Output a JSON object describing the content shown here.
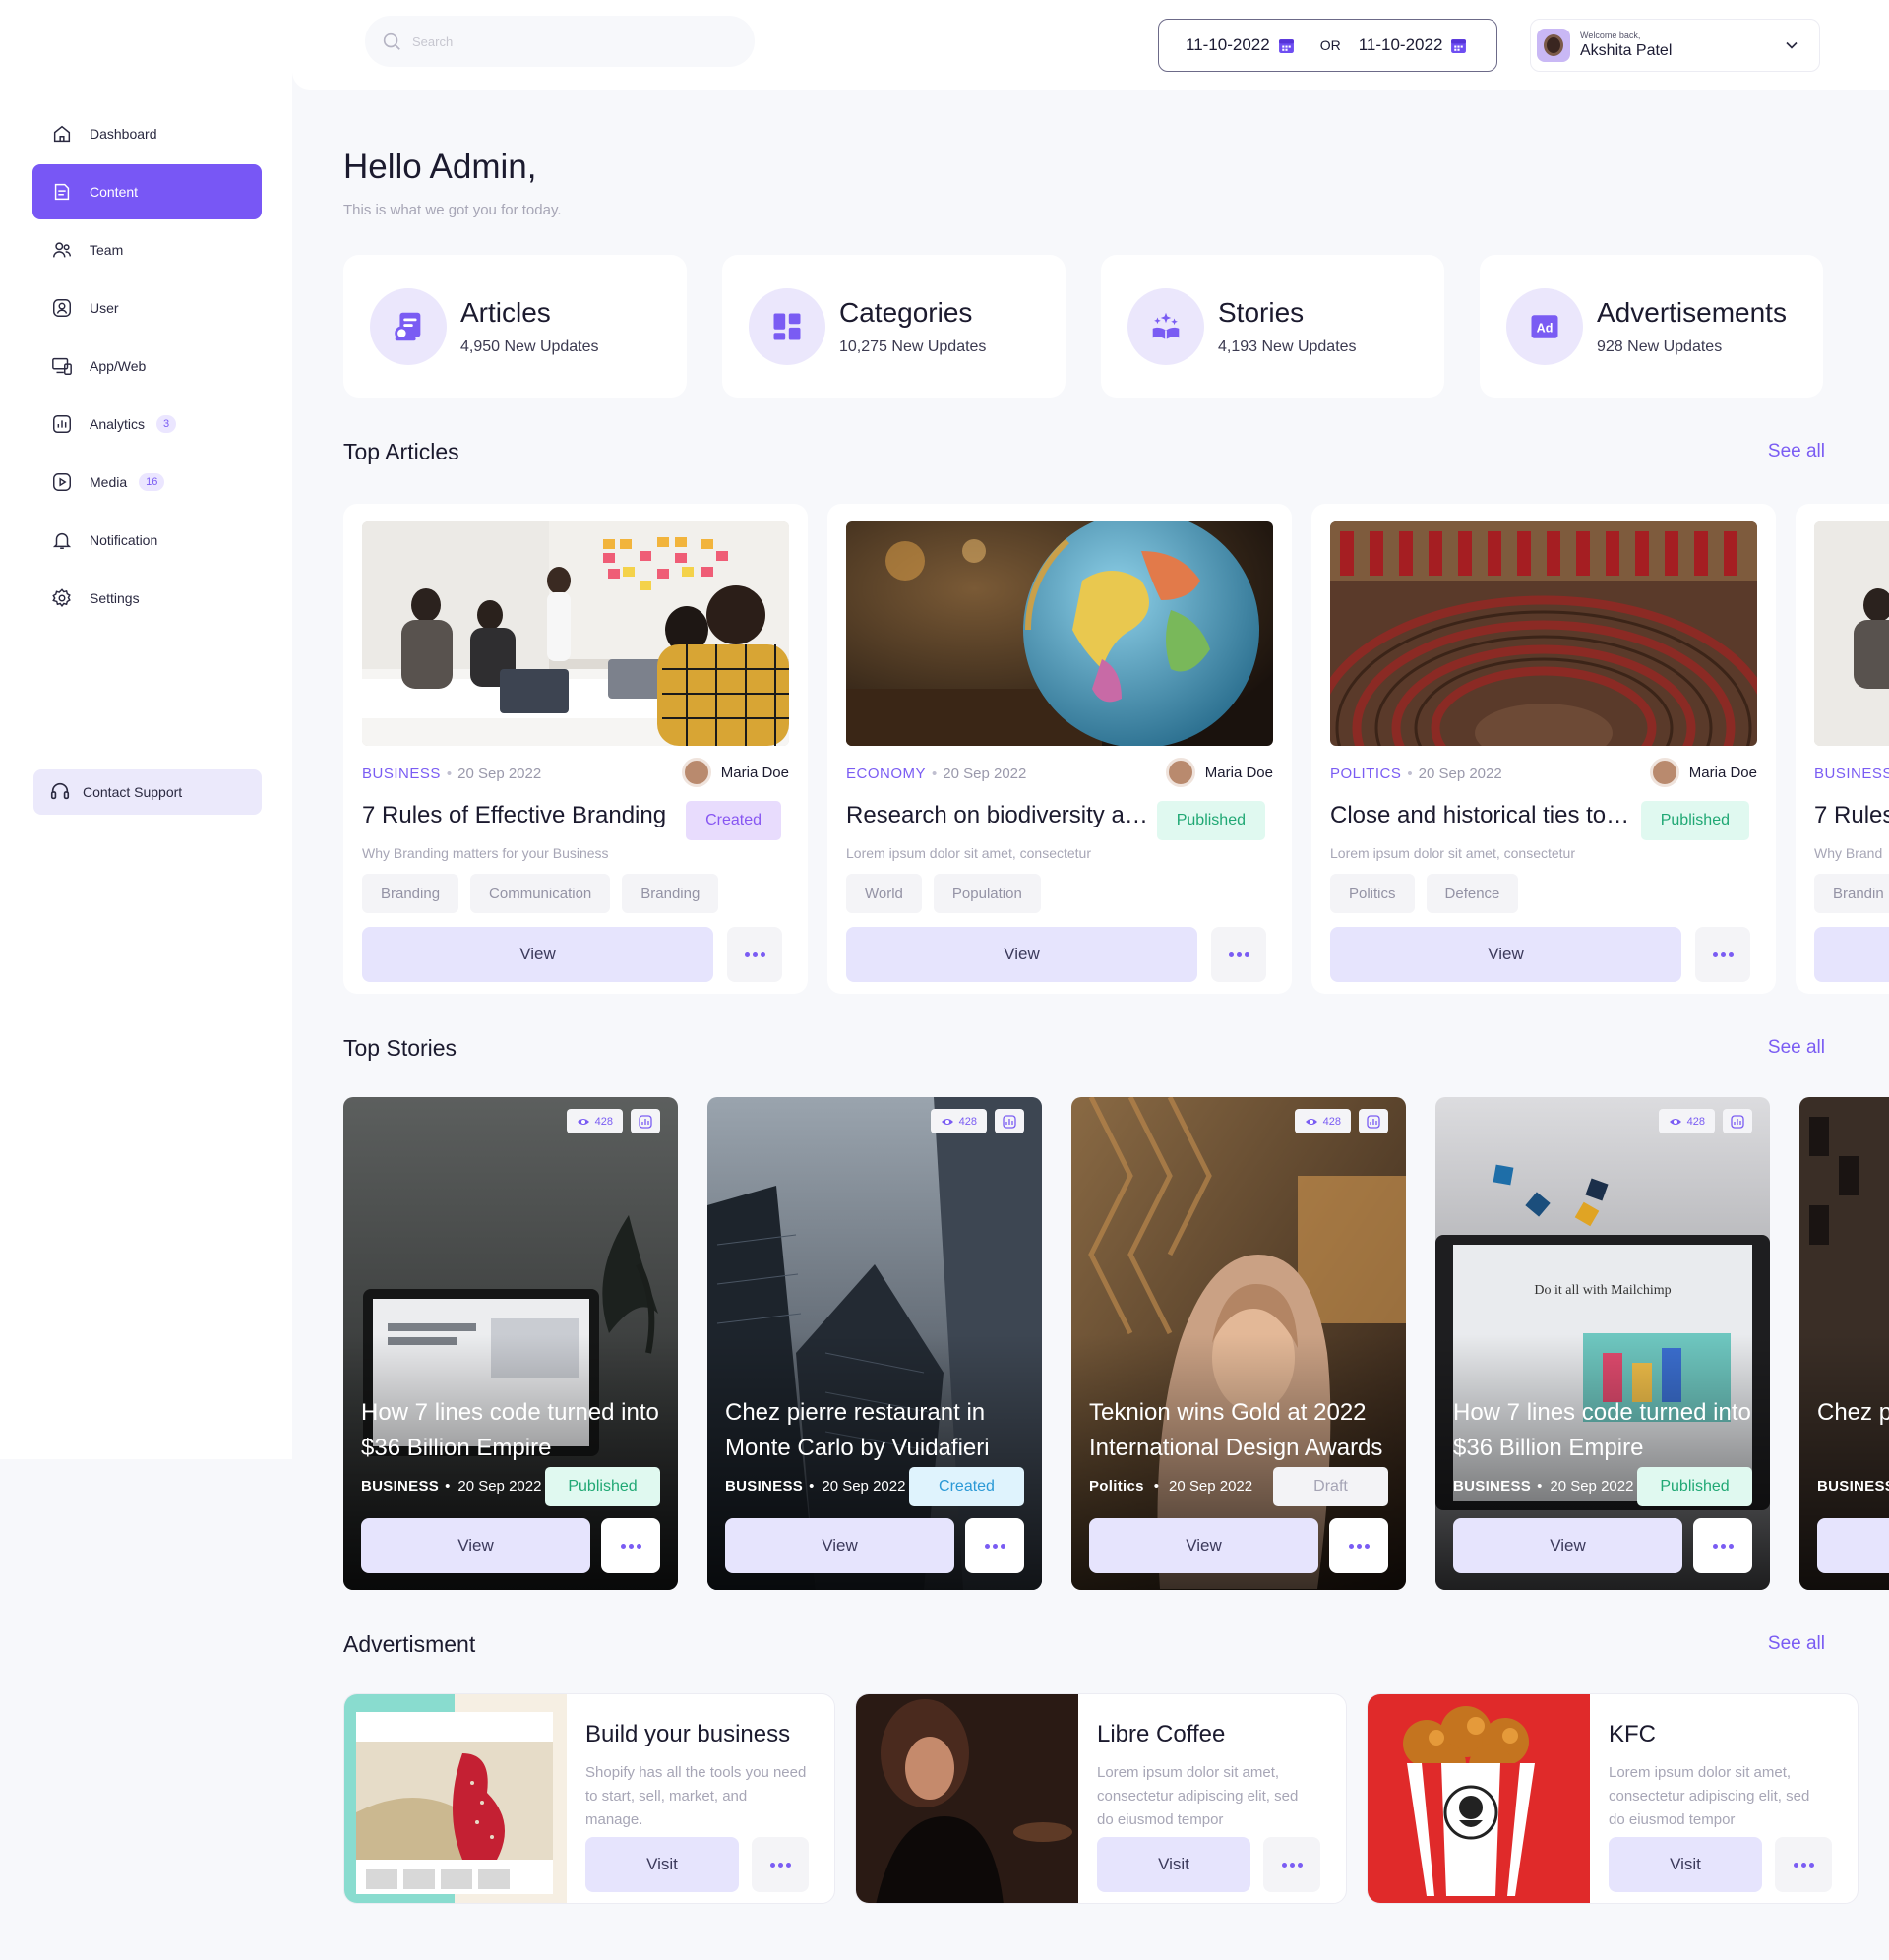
{
  "colors": {
    "accent": "#7857f5",
    "accent_light": "#e6e4fd",
    "published": "#20a874",
    "background": "#f7f8fb"
  },
  "sidebar": {
    "items": [
      {
        "label": "Dashboard",
        "icon": "home-icon"
      },
      {
        "label": "Content",
        "icon": "document-icon",
        "active": true
      },
      {
        "label": "Team",
        "icon": "team-icon"
      },
      {
        "label": "User",
        "icon": "user-icon"
      },
      {
        "label": "App/Web",
        "icon": "devices-icon"
      },
      {
        "label": "Analytics",
        "icon": "analytics-icon",
        "badge": "3"
      },
      {
        "label": "Media",
        "icon": "play-icon",
        "badge": "16"
      },
      {
        "label": "Notification",
        "icon": "bell-icon"
      },
      {
        "label": "Settings",
        "icon": "gear-icon"
      }
    ],
    "support_label": "Contact Support"
  },
  "topbar": {
    "search_placeholder": "Search",
    "date_from": "11-10-2022",
    "date_or": "OR",
    "date_to": "11-10-2022",
    "welcome": "Welcome back,",
    "user_name": "Akshita Patel"
  },
  "greeting": {
    "title": "Hello Admin,",
    "subtitle": "This is what we got you for today."
  },
  "stats": [
    {
      "title": "Articles",
      "sub": "4,950 New Updates"
    },
    {
      "title": "Categories",
      "sub": "10,275 New Updates"
    },
    {
      "title": "Stories",
      "sub": "4,193 New Updates"
    },
    {
      "title": "Advertisements",
      "sub": "928 New Updates"
    }
  ],
  "sections": {
    "top_articles": "Top Articles",
    "top_stories": "Top Stories",
    "advertisement": "Advertisment",
    "see_all": "See all"
  },
  "articles": [
    {
      "category": "BUSINESS",
      "date": "20 Sep 2022",
      "author": "Maria Doe",
      "title": "7 Rules of Effective Branding",
      "status": "Created",
      "desc": "Why Branding matters for your Business",
      "tags": [
        "Branding",
        "Communication",
        "Branding"
      ]
    },
    {
      "category": "ECONOMY",
      "date": "20 Sep 2022",
      "author": "Maria Doe",
      "title": "Research on biodiversity an...",
      "status": "Published",
      "desc": "Lorem ipsum dolor sit amet, consectetur",
      "tags": [
        "World",
        "Population"
      ]
    },
    {
      "category": "POLITICS",
      "date": "20 Sep 2022",
      "author": "Maria Doe",
      "title": "Close and historical ties to h...",
      "status": "Published",
      "desc": "Lorem ipsum dolor sit amet, consectetur",
      "tags": [
        "Politics",
        "Defence"
      ]
    },
    {
      "category": "BUSINESS",
      "title": "7 Rules",
      "desc": "Why Brand",
      "tags": [
        "Brandin"
      ]
    }
  ],
  "view_label": "View",
  "visit_label": "Visit",
  "stories": [
    {
      "views": "428",
      "title": "How 7 lines code turned into $36 Billion Empire",
      "category": "BUSINESS",
      "date": "20 Sep 2022",
      "status": "Published"
    },
    {
      "views": "428",
      "title": "Chez pierre restaurant in Monte Carlo by Vuidafieri",
      "category": "BUSINESS",
      "date": "20 Sep 2022",
      "status": "Created"
    },
    {
      "views": "428",
      "title": "Teknion wins Gold at 2022 International Design Awards",
      "category": "Politics",
      "date": "20 Sep 2022",
      "status": "Draft"
    },
    {
      "views": "428",
      "title": "How 7 lines code turned into $36 Billion Empire",
      "category": "BUSINESS",
      "date": "20 Sep 2022",
      "status": "Published"
    },
    {
      "title": "Chez p Monte",
      "category": "BUSINESS"
    }
  ],
  "ads": [
    {
      "title": "Build your business",
      "desc": "Shopify has all the tools you need to start, sell, market, and manage."
    },
    {
      "title": "Libre Coffee",
      "desc": "Lorem ipsum dolor sit amet, consectetur adipiscing elit, sed do eiusmod tempor"
    },
    {
      "title": "KFC",
      "desc": "Lorem ipsum dolor sit amet, consectetur adipiscing elit, sed do eiusmod tempor"
    }
  ]
}
